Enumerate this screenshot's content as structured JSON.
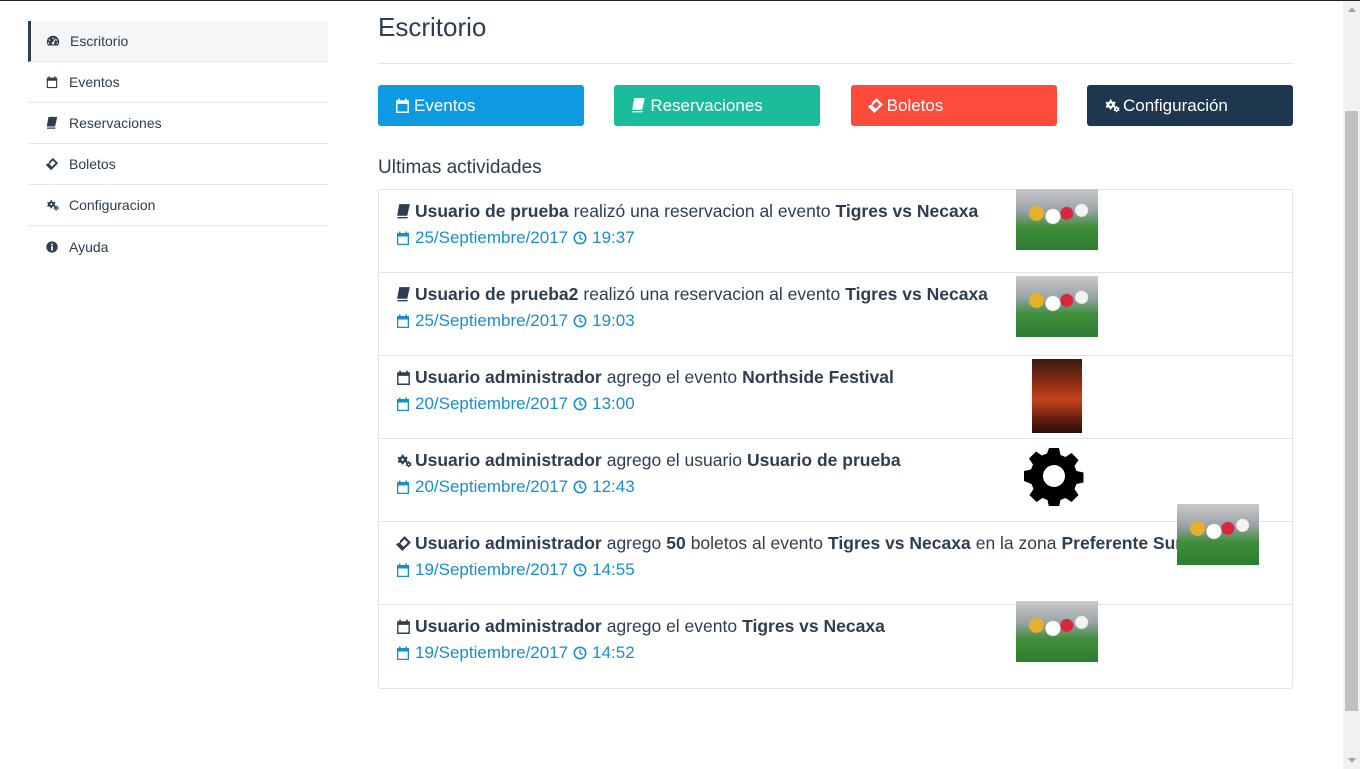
{
  "sidebar": {
    "items": [
      {
        "label": "Escritorio",
        "icon": "dashboard-icon",
        "active": true
      },
      {
        "label": "Eventos",
        "icon": "calendar-icon"
      },
      {
        "label": "Reservaciones",
        "icon": "book-icon"
      },
      {
        "label": "Boletos",
        "icon": "ticket-icon"
      },
      {
        "label": "Configuracion",
        "icon": "gears-icon"
      },
      {
        "label": "Ayuda",
        "icon": "info-icon"
      }
    ]
  },
  "main": {
    "title": "Escritorio",
    "buttons": [
      {
        "label": "Eventos",
        "icon": "calendar-icon",
        "color": "#0d9ae0"
      },
      {
        "label": "Reservaciones",
        "icon": "book-icon",
        "color": "#1abc9c"
      },
      {
        "label": "Boletos",
        "icon": "ticket-icon",
        "color": "#fd4c3c"
      },
      {
        "label": "Configuración",
        "icon": "gears-icon",
        "color": "#1e374e"
      }
    ],
    "section_title": "Ultimas actividades",
    "activities": [
      {
        "icon": "book-icon",
        "parts": [
          {
            "t": "Usuario de prueba",
            "b": true
          },
          {
            "t": "realizó una reservacion al evento",
            "b": false
          },
          {
            "t": "Tigres vs Necaxa",
            "b": true
          }
        ],
        "date": "25/Septiembre/2017",
        "time": "19:37",
        "thumb": "soccer-photo"
      },
      {
        "icon": "book-icon",
        "parts": [
          {
            "t": "Usuario de prueba2",
            "b": true
          },
          {
            "t": "realizó una reservacion al evento",
            "b": false
          },
          {
            "t": "Tigres vs Necaxa",
            "b": true
          }
        ],
        "date": "25/Septiembre/2017",
        "time": "19:03",
        "thumb": "soccer-photo"
      },
      {
        "icon": "calendar-icon",
        "parts": [
          {
            "t": "Usuario administrador",
            "b": true
          },
          {
            "t": "agrego el evento",
            "b": false
          },
          {
            "t": "Northside Festival",
            "b": true
          }
        ],
        "date": "20/Septiembre/2017",
        "time": "13:00",
        "thumb": "festival-poster"
      },
      {
        "icon": "gears-icon",
        "parts": [
          {
            "t": "Usuario administrador",
            "b": true
          },
          {
            "t": "agrego el usuario",
            "b": false
          },
          {
            "t": "Usuario de prueba",
            "b": true
          }
        ],
        "date": "20/Septiembre/2017",
        "time": "12:43",
        "thumb": "gear-icon"
      },
      {
        "icon": "ticket-icon",
        "parts": [
          {
            "t": "Usuario administrador",
            "b": true
          },
          {
            "t": "agrego",
            "b": false
          },
          {
            "t": "50",
            "b": true
          },
          {
            "t": "boletos al evento",
            "b": false
          },
          {
            "t": "Tigres vs Necaxa",
            "b": true
          },
          {
            "t": "en la zona",
            "b": false
          },
          {
            "t": "Preferente Sur",
            "b": true
          }
        ],
        "date": "19/Septiembre/2017",
        "time": "14:55",
        "thumb": "soccer-photo"
      },
      {
        "icon": "calendar-icon",
        "parts": [
          {
            "t": "Usuario administrador",
            "b": true
          },
          {
            "t": "agrego el evento",
            "b": false
          },
          {
            "t": "Tigres vs Necaxa",
            "b": true
          }
        ],
        "date": "19/Septiembre/2017",
        "time": "14:52",
        "thumb": "soccer-photo"
      }
    ]
  }
}
